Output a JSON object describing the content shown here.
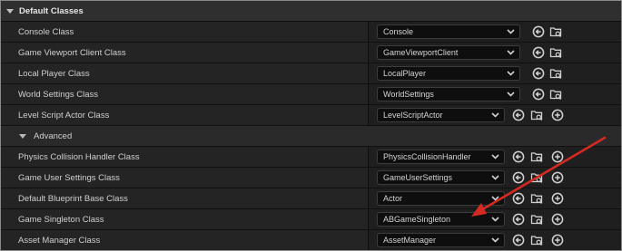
{
  "section": {
    "title": "Default Classes"
  },
  "advanced": {
    "title": "Advanced"
  },
  "rows_top": [
    {
      "label": "Console Class",
      "value": "Console"
    },
    {
      "label": "Game Viewport Client Class",
      "value": "GameViewportClient"
    },
    {
      "label": "Local Player Class",
      "value": "LocalPlayer"
    },
    {
      "label": "World Settings Class",
      "value": "WorldSettings"
    },
    {
      "label": "Level Script Actor Class",
      "value": "LevelScriptActor"
    }
  ],
  "rows_advanced": [
    {
      "label": "Physics Collision Handler Class",
      "value": "PhysicsCollisionHandler"
    },
    {
      "label": "Game User Settings Class",
      "value": "GameUserSettings"
    },
    {
      "label": "Default Blueprint Base Class",
      "value": "Actor"
    },
    {
      "label": "Game Singleton Class",
      "value": "ABGameSingleton"
    },
    {
      "label": "Asset Manager Class",
      "value": "AssetManager"
    }
  ],
  "colors": {
    "annotation_arrow": "#d42a22"
  }
}
